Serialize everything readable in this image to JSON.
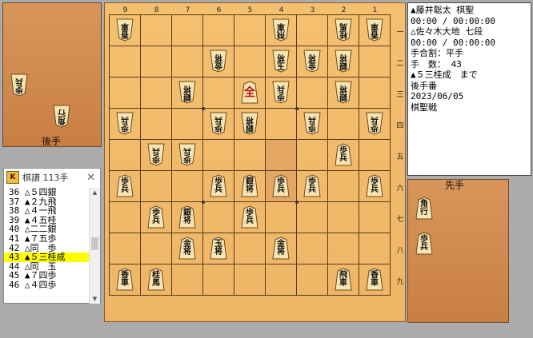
{
  "board": {
    "file_labels": [
      "9",
      "8",
      "7",
      "6",
      "5",
      "4",
      "3",
      "2",
      "1"
    ],
    "rank_labels": [
      "一",
      "二",
      "三",
      "四",
      "五",
      "六",
      "七",
      "八",
      "九"
    ],
    "pieces": [
      {
        "f": 9,
        "r": 1,
        "k": "香車",
        "s": "gote"
      },
      {
        "f": 4,
        "r": 1,
        "k": "飛車",
        "s": "gote"
      },
      {
        "f": 2,
        "r": 1,
        "k": "桂馬",
        "s": "gote"
      },
      {
        "f": 1,
        "r": 1,
        "k": "香車",
        "s": "gote"
      },
      {
        "f": 6,
        "r": 2,
        "k": "金将",
        "s": "gote"
      },
      {
        "f": 4,
        "r": 2,
        "k": "玉将",
        "s": "gote"
      },
      {
        "f": 3,
        "r": 2,
        "k": "金将",
        "s": "gote"
      },
      {
        "f": 2,
        "r": 2,
        "k": "銀将",
        "s": "gote"
      },
      {
        "f": 7,
        "r": 3,
        "k": "銀将",
        "s": "gote"
      },
      {
        "f": 5,
        "r": 3,
        "k": "全",
        "s": "sente",
        "promoted": true,
        "single": true
      },
      {
        "f": 4,
        "r": 3,
        "k": "歩兵",
        "s": "gote"
      },
      {
        "f": 2,
        "r": 3,
        "k": "銀将",
        "s": "gote"
      },
      {
        "f": 9,
        "r": 4,
        "k": "歩兵",
        "s": "gote"
      },
      {
        "f": 6,
        "r": 4,
        "k": "歩兵",
        "s": "gote"
      },
      {
        "f": 5,
        "r": 4,
        "k": "銀将",
        "s": "gote"
      },
      {
        "f": 3,
        "r": 4,
        "k": "歩兵",
        "s": "gote"
      },
      {
        "f": 1,
        "r": 4,
        "k": "歩兵",
        "s": "gote"
      },
      {
        "f": 8,
        "r": 5,
        "k": "歩兵",
        "s": "gote"
      },
      {
        "f": 7,
        "r": 5,
        "k": "歩兵",
        "s": "gote"
      },
      {
        "f": 2,
        "r": 5,
        "k": "歩兵",
        "s": "sente"
      },
      {
        "f": 9,
        "r": 6,
        "k": "歩兵",
        "s": "sente"
      },
      {
        "f": 6,
        "r": 6,
        "k": "歩兵",
        "s": "sente"
      },
      {
        "f": 5,
        "r": 6,
        "k": "銀将",
        "s": "sente"
      },
      {
        "f": 4,
        "r": 6,
        "k": "歩兵",
        "s": "sente"
      },
      {
        "f": 3,
        "r": 6,
        "k": "歩兵",
        "s": "sente"
      },
      {
        "f": 1,
        "r": 6,
        "k": "歩兵",
        "s": "sente"
      },
      {
        "f": 8,
        "r": 7,
        "k": "歩兵",
        "s": "sente"
      },
      {
        "f": 7,
        "r": 7,
        "k": "銀将",
        "s": "sente"
      },
      {
        "f": 5,
        "r": 7,
        "k": "歩兵",
        "s": "sente"
      },
      {
        "f": 7,
        "r": 8,
        "k": "金将",
        "s": "sente"
      },
      {
        "f": 6,
        "r": 8,
        "k": "玉将",
        "s": "sente"
      },
      {
        "f": 4,
        "r": 8,
        "k": "金将",
        "s": "sente"
      },
      {
        "f": 9,
        "r": 9,
        "k": "香車",
        "s": "sente"
      },
      {
        "f": 8,
        "r": 9,
        "k": "桂馬",
        "s": "sente"
      },
      {
        "f": 2,
        "r": 9,
        "k": "飛車",
        "s": "sente"
      },
      {
        "f": 1,
        "r": 9,
        "k": "香車",
        "s": "sente"
      }
    ],
    "highlight": [
      {
        "f": 4,
        "r": 5
      },
      {
        "f": 4,
        "r": 6
      }
    ]
  },
  "gote_hand": {
    "label": "後手",
    "pieces": [
      {
        "k": "歩兵"
      },
      {
        "k": "角行"
      }
    ]
  },
  "sente_hand": {
    "label": "先手",
    "pieces": [
      {
        "k": "角行"
      },
      {
        "k": "歩兵"
      }
    ]
  },
  "info": {
    "lines": [
      "▲藤井聡太 棋聖",
      "00:00 / 00:00:00",
      "△佐々木大地 七段",
      "00:00 / 00:00:00",
      "手合割：平手",
      "手　数： 43",
      "▲５三桂成　まで",
      "後手番",
      "2023/06/05",
      "棋聖戦"
    ]
  },
  "kifu": {
    "title": "棋譜 113手",
    "icon_text": "K",
    "close": "✕",
    "rows": [
      "36 △５四銀",
      "37 ▲２九飛",
      "38 △４一飛",
      "39 ▲４五桂",
      "40 △二二銀",
      "41 ▲７五歩",
      "42 △同　歩",
      "43 ▲５三桂成",
      "44 △同　玉",
      "45 ▲７四歩",
      "46 △４四歩"
    ],
    "selected_index": 7
  },
  "colors": {
    "board": "#f4c06f",
    "hand": "#cf8849",
    "selected": "#ffff00"
  }
}
